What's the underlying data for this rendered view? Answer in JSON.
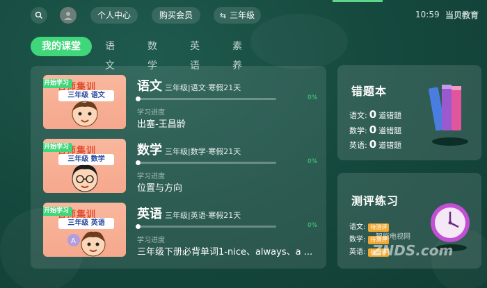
{
  "topbar": {
    "center_label": "个人中心",
    "vip_label": "购买会员",
    "grade_label": "三年级",
    "time": "10:59",
    "brand": "当贝教育"
  },
  "tabs": [
    "我的课堂",
    "语文",
    "数学",
    "英语",
    "素养"
  ],
  "courses": [
    {
      "badge": "开始学习",
      "thumb_title": "名师集训",
      "thumb_sub": "三年级 语文",
      "title": "语文",
      "meta": "三年级|语文·寒假21天",
      "progress_percent": 0,
      "progress_text": "0%",
      "progress_label": "学习进度",
      "lesson": "出塞-王昌龄"
    },
    {
      "badge": "开始学习",
      "thumb_title": "名师集训",
      "thumb_sub": "三年级 数学",
      "title": "数学",
      "meta": "三年级|数学·寒假21天",
      "progress_percent": 0,
      "progress_text": "0%",
      "progress_label": "学习进度",
      "lesson": "位置与方向"
    },
    {
      "badge": "开始学习",
      "thumb_title": "名师集训",
      "thumb_sub": "三年级 英语",
      "title": "英语",
      "meta": "三年级|英语·寒假21天",
      "progress_percent": 0,
      "progress_text": "0%",
      "progress_label": "学习进度",
      "lesson": "三年级下册必背单词1-nice、always、a ..."
    }
  ],
  "error_book": {
    "title": "错题本",
    "rows": [
      {
        "subject": "语文:",
        "count": "0",
        "unit": "道错题"
      },
      {
        "subject": "数学:",
        "count": "0",
        "unit": "道错题"
      },
      {
        "subject": "英语:",
        "count": "0",
        "unit": "道错题"
      }
    ]
  },
  "test_practice": {
    "title": "测评练习",
    "rows": [
      {
        "subject": "语文:",
        "tag": "待测评"
      },
      {
        "subject": "数学:",
        "tag": "待测评"
      },
      {
        "subject": "英语:",
        "tag": "待测评"
      }
    ]
  },
  "watermark": {
    "main": "ZNDS.com",
    "sub": "智能电视网"
  },
  "colors": {
    "accent": "#3fd77a",
    "background": "#164a3f",
    "tag": "#f1a933"
  }
}
